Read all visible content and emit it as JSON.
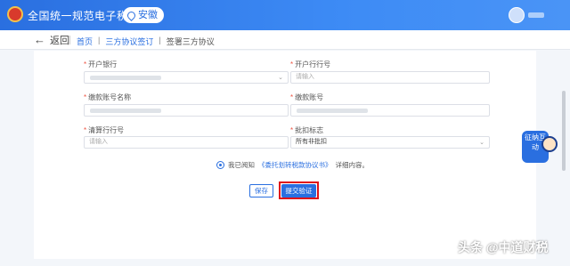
{
  "header": {
    "site_title": "全国统一规范电子税务局",
    "region": "安徽"
  },
  "nav": {
    "back_label": "返回",
    "breadcrumb": [
      "首页",
      "三方协议签订",
      "签署三方协议"
    ],
    "breadcrumb_separator": "|"
  },
  "form": {
    "open_bank": {
      "label": "开户银行",
      "value": ""
    },
    "open_bank_code": {
      "label": "开户行行号",
      "placeholder": "请输入"
    },
    "payer_account_name": {
      "label": "缴款账号名称",
      "value": ""
    },
    "payer_account_no": {
      "label": "缴款账号",
      "value": ""
    },
    "clearing_bank_code": {
      "label": "清算行行号",
      "placeholder": "请输入"
    },
    "deduction_flag": {
      "label": "批扣标志",
      "value": "所有非批扣"
    }
  },
  "agreement": {
    "prefix": "我已阅知",
    "doc_link": "《委托划转税款协议书》",
    "suffix": "详细内容。"
  },
  "buttons": {
    "save": "保存",
    "submit": "提交验证"
  },
  "helper": {
    "label": "征纳互动"
  },
  "watermark": "头条 @中道财税",
  "colors": {
    "primary": "#2a6fe0",
    "highlight_box": "#e0141a"
  },
  "icons": [
    "emblem-icon",
    "location-pin-icon",
    "user-avatar-icon",
    "back-arrow-icon",
    "chevron-down-icon",
    "radio-checked-icon",
    "service-assistant-icon"
  ]
}
